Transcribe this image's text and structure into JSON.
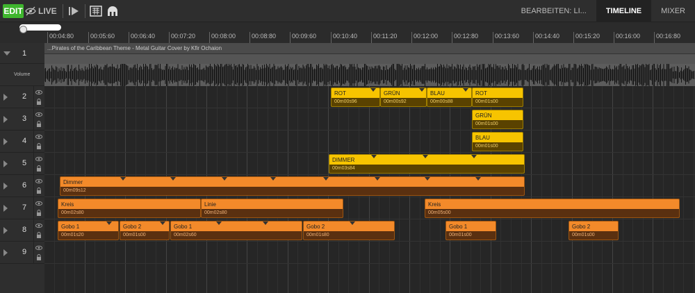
{
  "toolbar": {
    "edit_label": "EDIT",
    "live_label": "LIVE",
    "eye_icon": "eye-off-icon",
    "play_icon": "play-step-icon",
    "grid_icon": "grid-icon",
    "dome_icon": "dome-icon"
  },
  "nav": {
    "tabs": [
      {
        "label": "BEARBEITEN: LI...",
        "active": false
      },
      {
        "label": "TIMELINE",
        "active": true
      },
      {
        "label": "MIXER",
        "active": false
      }
    ]
  },
  "ruler": {
    "ticks": [
      "00:04:80",
      "00:05:60",
      "00:06:40",
      "00:07:20",
      "00:08:00",
      "00:08:80",
      "00:09:60",
      "00:10:40",
      "00:11:20",
      "00:12:00",
      "00:12:80",
      "00:13:60",
      "00:14:40",
      "00:15:20",
      "00:16:00",
      "00:16:80"
    ]
  },
  "audio": {
    "track_number": "1",
    "title": "...Pirates of the Caribbean Theme - Metal Guitar Cover by Kfir Ochaion",
    "volume_label": "Volume"
  },
  "tracks": [
    {
      "number": "2",
      "clips": [
        {
          "name": "ROT",
          "duration": "00m00s96",
          "color": "yellow"
        },
        {
          "name": "GRÜN",
          "duration": "00m00s92",
          "color": "yellow"
        },
        {
          "name": "BLAU",
          "duration": "00m00s88",
          "color": "yellow"
        },
        {
          "name": "ROT",
          "duration": "00m01s00",
          "color": "yellow"
        }
      ]
    },
    {
      "number": "3",
      "clips": [
        {
          "name": "GRÜN",
          "duration": "00m01s00",
          "color": "yellow"
        }
      ]
    },
    {
      "number": "4",
      "clips": [
        {
          "name": "BLAU",
          "duration": "00m01s00",
          "color": "yellow"
        }
      ]
    },
    {
      "number": "5",
      "clips": [
        {
          "name": "DIMMER",
          "duration": "00m03s84",
          "color": "yellow"
        }
      ]
    },
    {
      "number": "6",
      "clips": [
        {
          "name": "Dimmer",
          "duration": "00m09s12",
          "color": "orange"
        }
      ]
    },
    {
      "number": "7",
      "clips": [
        {
          "name": "Kreis",
          "duration": "00m02s80",
          "color": "orange"
        },
        {
          "name": "Linie",
          "duration": "00m02s80",
          "color": "orange"
        },
        {
          "name": "Kreis",
          "duration": "00m05s00",
          "color": "orange"
        }
      ]
    },
    {
      "number": "8",
      "clips": [
        {
          "name": "Gobo 1",
          "duration": "00m01s20",
          "color": "orange"
        },
        {
          "name": "Gobo 2",
          "duration": "00m01s00",
          "color": "orange"
        },
        {
          "name": "Gobo 1",
          "duration": "00m02s60",
          "color": "orange"
        },
        {
          "name": "Gobo 2",
          "duration": "00m01s80",
          "color": "orange"
        },
        {
          "name": "Gobo 1",
          "duration": "00m01s00",
          "color": "orange"
        },
        {
          "name": "Gobo 2",
          "duration": "00m01s00",
          "color": "orange"
        }
      ]
    },
    {
      "number": "9",
      "clips": []
    }
  ],
  "colors": {
    "edit_green": "#3fb62e",
    "clip_yellow": "#f7c400",
    "clip_orange": "#f38a2a"
  }
}
